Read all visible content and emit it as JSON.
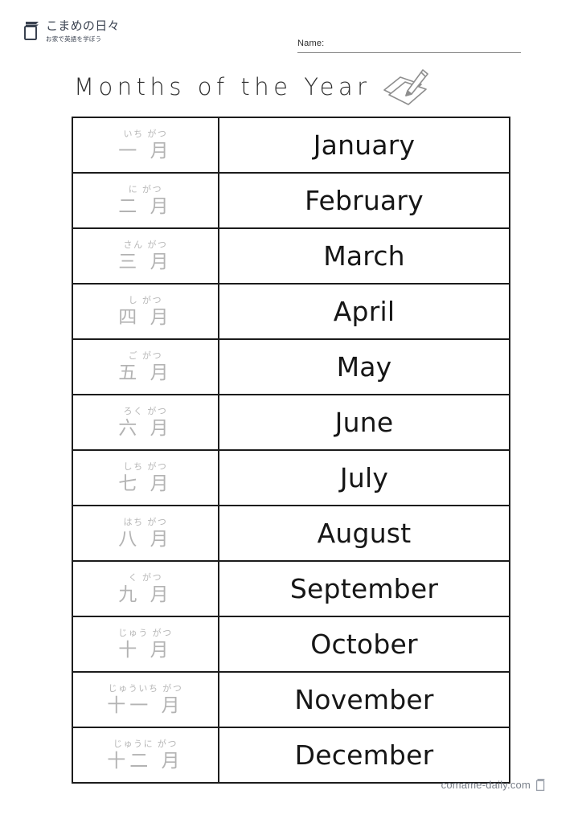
{
  "header": {
    "brand_title": "こまめの日々",
    "brand_subtitle": "お家で英語を学ぼう",
    "brand_icon": "book-icon",
    "name_label": "Name:"
  },
  "title": {
    "text": "Months of the Year",
    "icon": "pencil-writing-on-paper-icon"
  },
  "table": {
    "rows": [
      {
        "furigana": "いち がつ",
        "kanji": "一 月",
        "english": "January"
      },
      {
        "furigana": "に がつ",
        "kanji": "二 月",
        "english": "February"
      },
      {
        "furigana": "さん がつ",
        "kanji": "三 月",
        "english": "March"
      },
      {
        "furigana": "し がつ",
        "kanji": "四 月",
        "english": "April"
      },
      {
        "furigana": "ご がつ",
        "kanji": "五 月",
        "english": "May"
      },
      {
        "furigana": "ろく がつ",
        "kanji": "六 月",
        "english": "June"
      },
      {
        "furigana": "しち がつ",
        "kanji": "七 月",
        "english": "July"
      },
      {
        "furigana": "はち がつ",
        "kanji": "八 月",
        "english": "August"
      },
      {
        "furigana": "く がつ",
        "kanji": "九 月",
        "english": "September"
      },
      {
        "furigana": "じゅう がつ",
        "kanji": "十 月",
        "english": "October"
      },
      {
        "furigana": "じゅういち がつ",
        "kanji": "十一 月",
        "english": "November"
      },
      {
        "furigana": "じゅうに がつ",
        "kanji": "十二 月",
        "english": "December"
      }
    ]
  },
  "footer": {
    "site": "comame-daily.com",
    "icon": "book-icon"
  },
  "colors": {
    "table_border": "#1c1c1c",
    "english_text": "#161616",
    "japanese_text": "#b3b3b3",
    "furigana_text": "#b7b7b7",
    "brand_text": "#3a4250",
    "footer_text": "#7a808a",
    "name_rule": "#8a8a8a"
  }
}
